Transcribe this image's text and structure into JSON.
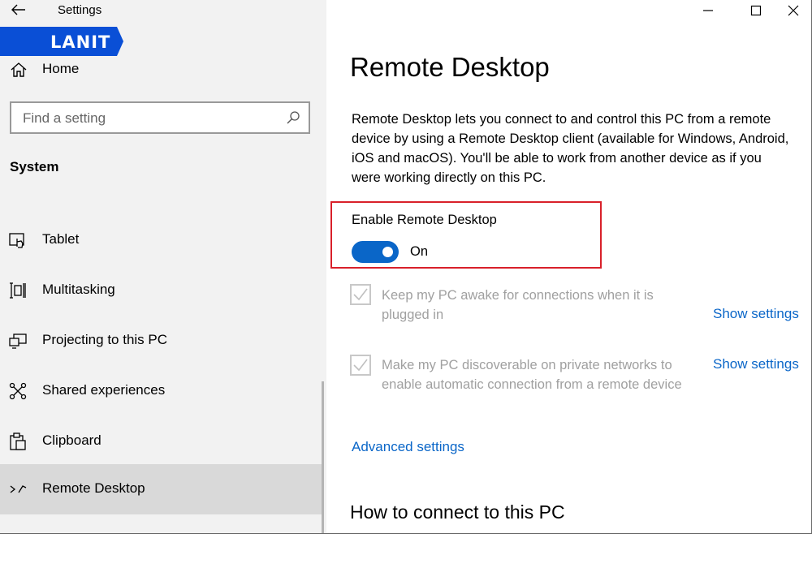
{
  "window": {
    "app_title": "Settings"
  },
  "watermark": {
    "text": "LANIT",
    "color": "#0a4fd6"
  },
  "sidebar": {
    "home_label": "Home",
    "search_placeholder": "Find a setting",
    "section_title": "System",
    "items": [
      {
        "label": "Tablet",
        "icon": "tablet-icon"
      },
      {
        "label": "Multitasking",
        "icon": "multitasking-icon"
      },
      {
        "label": "Projecting to this PC",
        "icon": "projecting-icon"
      },
      {
        "label": "Shared experiences",
        "icon": "shared-experiences-icon"
      },
      {
        "label": "Clipboard",
        "icon": "clipboard-icon"
      },
      {
        "label": "Remote Desktop",
        "icon": "remote-desktop-icon",
        "active": true
      }
    ]
  },
  "main": {
    "title": "Remote Desktop",
    "description": "Remote Desktop lets you connect to and control this PC from a remote device by using a Remote Desktop client (available for Windows, Android, iOS and macOS). You'll be able to work from another device as if you were working directly on this PC.",
    "toggle": {
      "label": "Enable Remote Desktop",
      "state": "On",
      "on": true
    },
    "options": [
      {
        "text": "Keep my PC awake for connections when it is plugged in",
        "checked": true,
        "link": "Show settings"
      },
      {
        "text": "Make my PC discoverable on private networks to enable automatic connection from a remote device",
        "checked": true,
        "link": "Show settings"
      }
    ],
    "advanced_link": "Advanced settings",
    "section2_title": "How to connect to this PC"
  },
  "colors": {
    "accent": "#0a66c8",
    "highlight_border": "#d9202a",
    "sidebar_bg": "#f2f2f2",
    "active_item_bg": "#d9d9d9"
  }
}
